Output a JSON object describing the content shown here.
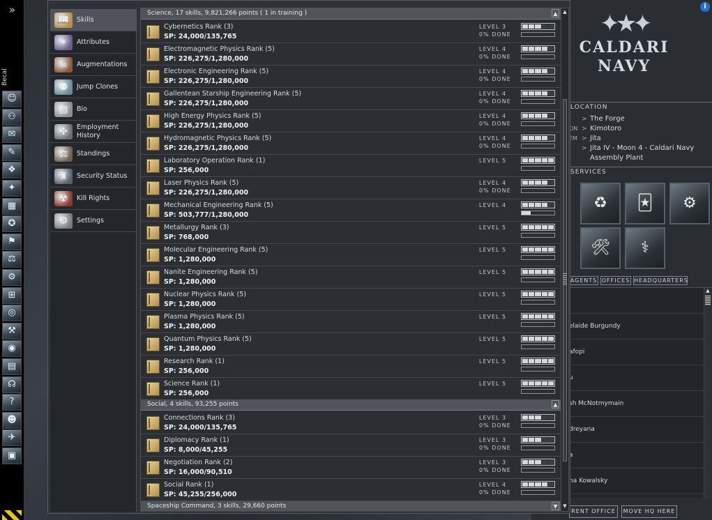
{
  "character": {
    "name": "Becal"
  },
  "neocom": {
    "icons": [
      "portrait-icon",
      "people-icon",
      "mail-icon",
      "notepad-icon",
      "map-icon",
      "starmap-icon",
      "assets-icon",
      "fitting-icon",
      "corporation-icon",
      "market-icon",
      "industry-icon",
      "calculator-icon",
      "help-icon",
      "drones-icon",
      "browser-icon",
      "journal-icon",
      "chat-icon",
      "info-icon",
      "avatar-icon",
      "ship-icon",
      "cargo-icon"
    ],
    "glyphs": [
      "☺",
      "⚇",
      "✉",
      "✎",
      "❖",
      "✦",
      "▦",
      "✪",
      "⚑",
      "⚖",
      "⚙",
      "⊞",
      "◎",
      "⚒",
      "◉",
      "▤",
      "☊",
      "?",
      "☻",
      "✈",
      "▣"
    ]
  },
  "categories": [
    {
      "label": "Skills",
      "icon": "book-icon",
      "glyph": "📖",
      "color": "#b4914c",
      "active": true
    },
    {
      "label": "Attributes",
      "icon": "attributes-icon",
      "glyph": "✴",
      "color": "#6a5e8f"
    },
    {
      "label": "Augmentations",
      "icon": "augmentations-icon",
      "glyph": "☠",
      "color": "#8a5a3a"
    },
    {
      "label": "Jump Clones",
      "icon": "jump-clones-icon",
      "glyph": "⚉",
      "color": "#6f8a9a"
    },
    {
      "label": "Bio",
      "icon": "bio-icon",
      "glyph": "▤",
      "color": "#8a8e92"
    },
    {
      "label": "Employment History",
      "icon": "employment-icon",
      "glyph": "✣",
      "color": "#6a6e72"
    },
    {
      "label": "Standings",
      "icon": "standings-icon",
      "glyph": "⚖",
      "color": "#6f6052"
    },
    {
      "label": "Security Status",
      "icon": "security-icon",
      "glyph": "♜",
      "color": "#5e6266"
    },
    {
      "label": "Kill Rights",
      "icon": "kill-rights-icon",
      "glyph": "☢",
      "color": "#8a3a2e"
    },
    {
      "label": "Settings",
      "icon": "settings-icon",
      "glyph": "⚙",
      "color": "#7a7e82"
    }
  ],
  "skill_groups": [
    {
      "header": "Science, 17 skills, 9,821,266 points ( 1 in training )",
      "skills": [
        {
          "name": "Cybernetics Rank (3)",
          "sp": "SP: 24,000/135,765",
          "level": "LEVEL 3",
          "done": "0% DONE",
          "lvl": 3,
          "progress": 0
        },
        {
          "name": "Electromagnetic Physics Rank (5)",
          "sp": "SP: 226,275/1,280,000",
          "level": "LEVEL 4",
          "done": "0% DONE",
          "lvl": 4,
          "progress": 0
        },
        {
          "name": "Electronic Engineering Rank (5)",
          "sp": "SP: 226,275/1,280,000",
          "level": "LEVEL 4",
          "done": "0% DONE",
          "lvl": 4,
          "progress": 0
        },
        {
          "name": "Gallentean Starship Engineering Rank (5)",
          "sp": "SP: 226,275/1,280,000",
          "level": "LEVEL 4",
          "done": "0% DONE",
          "lvl": 4,
          "progress": 0
        },
        {
          "name": "High Energy Physics Rank (5)",
          "sp": "SP: 226,275/1,280,000",
          "level": "LEVEL 4",
          "done": "0% DONE",
          "lvl": 4,
          "progress": 0
        },
        {
          "name": "Hydromagnetic Physics Rank (5)",
          "sp": "SP: 226,275/1,280,000",
          "level": "LEVEL 4",
          "done": "0% DONE",
          "lvl": 4,
          "progress": 0
        },
        {
          "name": "Laboratory Operation Rank (1)",
          "sp": "SP: 256,000",
          "level": "LEVEL 5",
          "done": "",
          "lvl": 5,
          "progress": 0
        },
        {
          "name": "Laser Physics Rank (5)",
          "sp": "SP: 226,275/1,280,000",
          "level": "LEVEL 4",
          "done": "0% DONE",
          "lvl": 4,
          "progress": 0
        },
        {
          "name": "Mechanical Engineering Rank (5)",
          "sp": "SP: 503,777/1,280,000",
          "level": "LEVEL 4",
          "done": "",
          "lvl": 4,
          "progress": 0.27,
          "training": true
        },
        {
          "name": "Metallurgy Rank (3)",
          "sp": "SP: 768,000",
          "level": "LEVEL 5",
          "done": "",
          "lvl": 5,
          "progress": 0
        },
        {
          "name": "Molecular Engineering Rank (5)",
          "sp": "SP: 1,280,000",
          "level": "LEVEL 5",
          "done": "",
          "lvl": 5,
          "progress": 0
        },
        {
          "name": "Nanite Engineering Rank (5)",
          "sp": "SP: 1,280,000",
          "level": "LEVEL 5",
          "done": "",
          "lvl": 5,
          "progress": 0
        },
        {
          "name": "Nuclear Physics Rank (5)",
          "sp": "SP: 1,280,000",
          "level": "LEVEL 5",
          "done": "",
          "lvl": 5,
          "progress": 0
        },
        {
          "name": "Plasma Physics Rank (5)",
          "sp": "SP: 1,280,000",
          "level": "LEVEL 5",
          "done": "",
          "lvl": 5,
          "progress": 0
        },
        {
          "name": "Quantum Physics Rank (5)",
          "sp": "SP: 1,280,000",
          "level": "LEVEL 5",
          "done": "",
          "lvl": 5,
          "progress": 0
        },
        {
          "name": "Research Rank (1)",
          "sp": "SP: 256,000",
          "level": "LEVEL 5",
          "done": "",
          "lvl": 5,
          "progress": 0
        },
        {
          "name": "Science Rank (1)",
          "sp": "SP: 256,000",
          "level": "LEVEL 5",
          "done": "",
          "lvl": 5,
          "progress": 0
        }
      ]
    },
    {
      "header": "Social, 4 skills, 93,255 points",
      "skills": [
        {
          "name": "Connections Rank (3)",
          "sp": "SP: 24,000/135,765",
          "level": "LEVEL 3",
          "done": "0% DONE",
          "lvl": 3,
          "progress": 0
        },
        {
          "name": "Diplomacy Rank (1)",
          "sp": "SP: 8,000/45,255",
          "level": "LEVEL 3",
          "done": "0% DONE",
          "lvl": 3,
          "progress": 0
        },
        {
          "name": "Negotiation Rank (2)",
          "sp": "SP: 16,000/90,510",
          "level": "LEVEL 3",
          "done": "0% DONE",
          "lvl": 3,
          "progress": 0
        },
        {
          "name": "Social Rank (1)",
          "sp": "SP: 45,255/256,000",
          "level": "LEVEL 4",
          "done": "0% DONE",
          "lvl": 4,
          "progress": 0
        }
      ]
    },
    {
      "header": "Spaceship Command, 3 skills, 29,660 points",
      "skills": []
    }
  ],
  "station": {
    "logo_line1": "CALDARI",
    "logo_line2": "NAVY",
    "location_header": "LOCATION",
    "location": [
      {
        "key": "",
        "value": "The Forge"
      },
      {
        "key": "ON",
        "value": "Kimotoro"
      },
      {
        "key": "EM",
        "value": "Jita"
      },
      {
        "key": "",
        "value": "Jita IV - Moon 4 - Caldari Navy"
      },
      {
        "key": "",
        "value": "Assembly Plant",
        "noarrow": true
      }
    ],
    "services_header": "SERVICES",
    "services": [
      "refinery-icon",
      "reprocessing-icon",
      "market-service-icon",
      "fitting-service-icon",
      "medical-icon",
      "repair-icon",
      "cloning-icon"
    ],
    "service_glyphs": [
      "🏭",
      "♻",
      "🃏",
      "⚙",
      "✚",
      "🛠",
      "⚕"
    ],
    "tabs": [
      "AGENTS",
      "OFFICES",
      "HEADQUARTERS"
    ],
    "agents": [
      "i",
      "elaide Burgundy",
      "afopi",
      "u",
      "sh McNotmymain",
      "dreyana",
      "a",
      "na Kowalsky"
    ],
    "buttons": [
      "RENT OFFICE",
      "MOVE HQ HERE"
    ]
  }
}
